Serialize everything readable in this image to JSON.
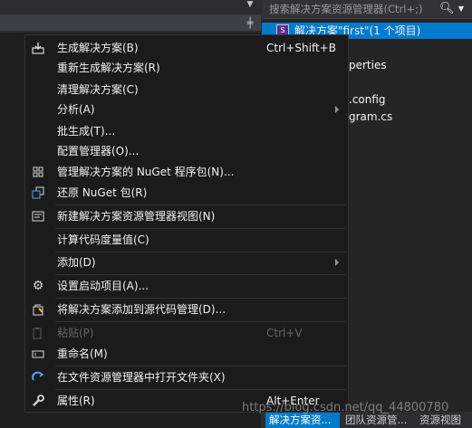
{
  "solution_explorer": {
    "search_placeholder": "搜索解决方案资源管理器(Ctrl+;)",
    "solution_row": "解决方案\"first\"(1 个项目)",
    "partial_rows": [
      "perties",
      ".config",
      "gram.cs"
    ]
  },
  "bottom_tabs": [
    "解决方案资...",
    "团队资源管...",
    "资源视图"
  ],
  "menu": {
    "items": [
      {
        "label": "生成解决方案(B)",
        "shortcut": "Ctrl+Shift+B",
        "icon": "build-icon"
      },
      {
        "label": "重新生成解决方案(R)",
        "shortcut": ""
      },
      {
        "label": "清理解决方案(C)",
        "shortcut": ""
      },
      {
        "label": "分析(A)",
        "shortcut": "",
        "submenu": true
      },
      {
        "label": "批生成(T)...",
        "shortcut": ""
      },
      {
        "label": "配置管理器(O)...",
        "shortcut": ""
      },
      {
        "label": "管理解决方案的 NuGet 程序包(N)...",
        "shortcut": "",
        "icon": "nuget-package-icon"
      },
      {
        "label": "还原 NuGet 包(R)",
        "shortcut": "",
        "icon": "restore-package-icon"
      },
      {
        "label": "新建解决方案资源管理器视图(N)",
        "shortcut": "",
        "icon": "new-view-icon"
      },
      {
        "label": "计算代码度量值(C)",
        "shortcut": ""
      },
      {
        "label": "添加(D)",
        "shortcut": "",
        "submenu": true
      },
      {
        "label": "设置启动项目(A)...",
        "shortcut": "",
        "icon": "gear-icon"
      },
      {
        "label": "将解决方案添加到源代码管理(D)...",
        "shortcut": "",
        "icon": "source-control-add-icon"
      },
      {
        "label": "粘贴(P)",
        "shortcut": "Ctrl+V",
        "disabled": true,
        "icon": "paste-icon"
      },
      {
        "label": "重命名(M)",
        "shortcut": "",
        "icon": "rename-icon"
      },
      {
        "label": "在文件资源管理器中打开文件夹(X)",
        "shortcut": "",
        "icon": "open-folder-refresh-icon"
      },
      {
        "label": "属性(R)",
        "shortcut": "Alt+Enter",
        "icon": "wrench-icon"
      }
    ]
  },
  "watermark": "https://blog.csdn.net/qq_44800780"
}
